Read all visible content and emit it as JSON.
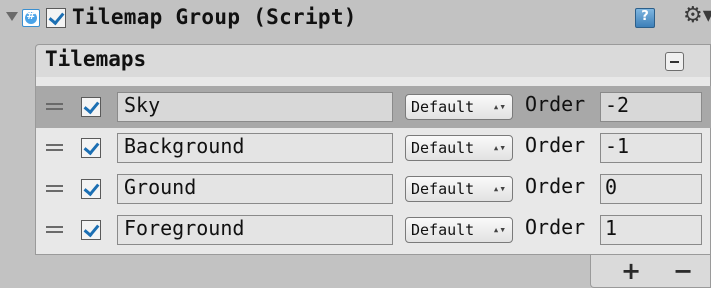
{
  "component": {
    "title": "Tilemap Group (Script)",
    "enabled": true,
    "icons": [
      "foldout-arrow",
      "script-icon",
      "help-icon",
      "gear-icon"
    ]
  },
  "list": {
    "header_label": "Tilemaps",
    "collapse_symbol": "−",
    "items": [
      {
        "enabled": true,
        "name": "Sky",
        "sorting_layer": "Default",
        "order_label": "Order",
        "order": "-2",
        "selected": true
      },
      {
        "enabled": true,
        "name": "Background",
        "sorting_layer": "Default",
        "order_label": "Order",
        "order": "-1",
        "selected": false
      },
      {
        "enabled": true,
        "name": "Ground",
        "sorting_layer": "Default",
        "order_label": "Order",
        "order": "0",
        "selected": false
      },
      {
        "enabled": true,
        "name": "Foreground",
        "sorting_layer": "Default",
        "order_label": "Order",
        "order": "1",
        "selected": false
      }
    ],
    "add_label": "+",
    "remove_label": "−"
  },
  "colors": {
    "background": "#c2c2c2",
    "selected_row": "#a8a8a8",
    "checkmark": "#1c6fb3"
  }
}
